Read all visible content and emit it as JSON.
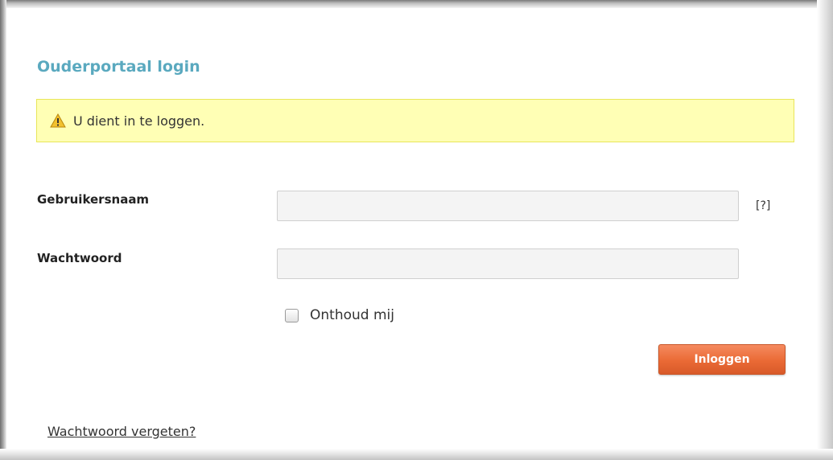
{
  "title": "Ouderportaal login",
  "alert": {
    "icon": "warning-icon",
    "message": "U dient in te loggen.",
    "background": "#ffffb5",
    "border": "#e8e55a"
  },
  "form": {
    "username_label": "Gebruikersnaam",
    "username_value": "",
    "username_help": "[?]",
    "password_label": "Wachtwoord",
    "password_value": "",
    "remember_label": "Onthoud mij",
    "remember_checked": false,
    "submit_label": "Inloggen"
  },
  "forgot_link": "Wachtwoord vergeten?",
  "colors": {
    "title": "#5aa9bf",
    "button": "#ea6a35"
  }
}
